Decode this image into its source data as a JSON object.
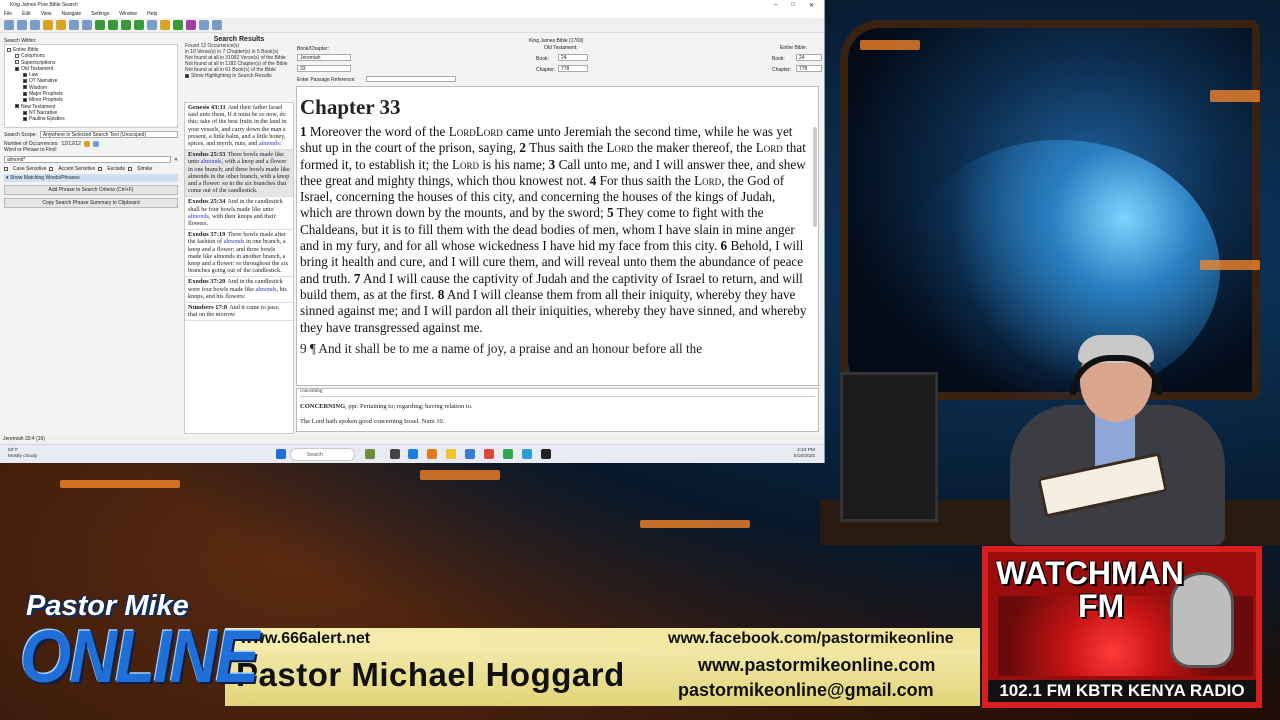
{
  "app": {
    "window_title": "King James Pure Bible Search",
    "menu": [
      "File",
      "Edit",
      "View",
      "Navigate",
      "Settings",
      "Window",
      "Help"
    ],
    "search_within_label": "Search Within:",
    "tree": [
      {
        "label": "Entire Bible",
        "checked": false
      },
      {
        "label": "Colophons",
        "checked": false
      },
      {
        "label": "Superscriptions",
        "checked": false
      },
      {
        "label": "Old Testament",
        "checked": true
      },
      {
        "label": "Law",
        "checked": true
      },
      {
        "label": "OT Narrative",
        "checked": true
      },
      {
        "label": "Wisdom",
        "checked": true
      },
      {
        "label": "Major Prophets",
        "checked": true
      },
      {
        "label": "Minor Prophets",
        "checked": true
      },
      {
        "label": "New Testament",
        "checked": true
      },
      {
        "label": "NT Narrative",
        "checked": true
      },
      {
        "label": "Pauline Epistles",
        "checked": true
      }
    ],
    "search_scope_label": "Search Scope:",
    "search_scope_value": "Anywhere in Selected Search Text (Unscoped)",
    "occurrences_label": "Number of Occurrences:",
    "occurrences_value": "12/12/12",
    "phrase_label": "Word or Phrase to Find:",
    "phrase_value": "almond*",
    "options": [
      "Case Sensitive",
      "Accent Sensitive",
      "Exclude",
      "Similar"
    ],
    "show_matching": "Show Matching Words/Phrases",
    "add_phrase_button": "Add Phrase to Search Criteria (Ctrl+F)",
    "copy_summary_button": "Copy Search Phrase Summary to Clipboard",
    "status_text": "Jeremiah 33:4 (16)"
  },
  "results": {
    "title": "Search Results",
    "stats": [
      "Found 12 Occurrence(s)",
      "in 10 Verse(s) in 7 Chapter(s) in 5 Book(s)",
      "Not found at all in 31092 Verse(s) of the Bible",
      "Not found at all in 1182 Chapter(s) of the Bible",
      "Not found at all in 61 Book(s) of the Bible"
    ],
    "highlight_option": "Show Highlighting in Search Results",
    "items": [
      {
        "ref": "Genesis 43:11",
        "pre": "And their father Israel said unto them, If it must be so now, do this; take of the best fruits in the land in your vessels, and carry down the man a present, a little balm, and a little honey, spices, and myrrh, nuts, and ",
        "hit": "almonds",
        "post": ":",
        "selected": false
      },
      {
        "ref": "Exodus 25:33",
        "pre": "Three bowls made like unto ",
        "hit": "almonds",
        "post": ", with a knop and a flower in one branch; and three bowls made like almonds in the other branch, with a knop and a flower: so in the six branches that come out of the candlestick.",
        "selected": true
      },
      {
        "ref": "Exodus 25:34",
        "pre": "And in the candlestick shall be four bowls made like unto ",
        "hit": "almonds",
        "post": ", with their knops and their flowers.",
        "selected": false
      },
      {
        "ref": "Exodus 37:19",
        "pre": "Three bowls made after the fashion of ",
        "hit": "almonds",
        "post": " in one branch, a knop and a flower; and three bowls made like almonds in another branch, a knop and a flower: so throughout the six branches going out of the candlestick.",
        "selected": false
      },
      {
        "ref": "Exodus 37:20",
        "pre": "And in the candlestick were four bowls made like ",
        "hit": "almonds",
        "post": ", his knops, and his flowers:",
        "selected": false
      },
      {
        "ref": "Numbers 17:8",
        "pre": "And it came to pass, that on the morrow",
        "hit": "",
        "post": "",
        "selected": false
      }
    ]
  },
  "navigation": {
    "book_chapter_label": "Book/Chapter:",
    "book_value": "Jeremiah",
    "chapter_value": "33",
    "passage_ref_label": "Enter Passage Reference:",
    "bible_title": "King James Bible (1769)",
    "ot_label": "Old Testament:",
    "book_label": "Book:",
    "chapter_label": "Chapter:",
    "ot_book_num": "24",
    "ot_chapter_num": "778",
    "entire_label": "Entire Bible:",
    "entire_book_num": "24",
    "entire_chapter_num": "778"
  },
  "reader": {
    "chapter_heading": "Chapter 33",
    "lord": "Lord",
    "verses": [
      {
        "n": "1",
        "t": "Moreover the word of the "
      },
      {
        "n": "",
        "t": " came unto Jeremiah the second time, while he was yet shut up in the court of the prison, saying, "
      },
      {
        "n": "2",
        "t": "Thus saith the "
      },
      {
        "n": "",
        "t": " the maker thereof, the "
      },
      {
        "n": "",
        "t": " that formed it, to establish it; the "
      },
      {
        "n": "",
        "t": " is his name; "
      },
      {
        "n": "3",
        "t": "Call unto me, and I will answer thee, and shew thee great and mighty things, which thou knowest not. "
      },
      {
        "n": "4",
        "t": "For thus saith the "
      },
      {
        "n": "",
        "t": ", the God of Israel, concerning the houses of this city, and concerning the houses of the kings of Judah, which are thrown down by the mounts, and by the sword; "
      },
      {
        "n": "5",
        "t": "They come to fight with the Chaldeans, but it is to fill them with the dead bodies of men, whom I have slain in mine anger and in my fury, and for all whose wickedness I have hid my face from this city. "
      },
      {
        "n": "6",
        "t": "Behold, I will bring it health and cure, and I will cure them, and will reveal unto them the abundance of peace and truth. "
      },
      {
        "n": "7",
        "t": "And I will cause the captivity of Judah and the captivity of Israel to return, and will build them, as at the first. "
      },
      {
        "n": "8",
        "t": "And I will cleanse them from all their iniquity, whereby they have sinned against me; and I will pardon all their iniquities, whereby they have sinned, and whereby they have transgressed against me."
      }
    ],
    "next_verse": "9 ¶ And it shall be to me a name of joy, a praise and an honour before all the"
  },
  "dictionary": {
    "word": "concerning",
    "headword": "CONCERNING",
    "definition": ", ppr. Pertaining to; regarding; having relation to.",
    "example": "The Lord hath spoken good concerning Israel. Num 10."
  },
  "taskbar": {
    "weather_temp": "62°F",
    "weather_desc": "Mostly cloudy",
    "search_placeholder": "Search",
    "time": "2:24 PM",
    "date": "5/16/2025"
  },
  "overlay": {
    "brand_top": "Pastor Mike",
    "brand_bottom": "ONLINE",
    "url_left": "www.666alert.net",
    "url_right": "www.facebook.com/pastormikeonline",
    "host_name": "Pastor Michael Hoggard",
    "url_right_2": "www.pastormikeonline.com",
    "email": "pastormikeonline@gmail.com",
    "radio_title": "WATCHMAN",
    "radio_fm": "FM",
    "radio_sub": "102.1 FM  KBTR KENYA  RADIO"
  },
  "colors": {
    "hit": "#2a39c9",
    "banner": "#f0e49a",
    "brand_blue": "#1f6fd6",
    "radio_red": "#d81e1e"
  }
}
